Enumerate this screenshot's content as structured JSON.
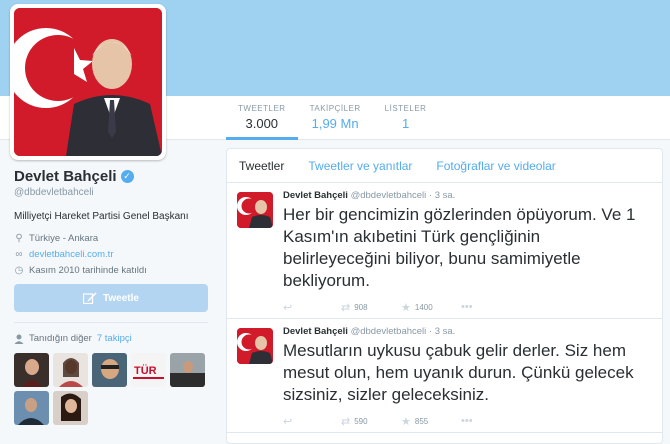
{
  "profile": {
    "name": "Devlet Bahçeli",
    "handle": "@dbdevletbahceli",
    "bio": "Milliyetçi Hareket Partisi Genel Başkanı",
    "location": "Türkiye - Ankara",
    "website": "devletbahceli.com.tr",
    "joined": "Kasım 2010 tarihinde katıldı",
    "tweet_button": "Tweetle"
  },
  "stats": [
    {
      "label": "TWEETLER",
      "value": "3.000"
    },
    {
      "label": "TAKİPÇİLER",
      "value": "1,99 Mn"
    },
    {
      "label": "LİSTELER",
      "value": "1"
    }
  ],
  "known_followers": {
    "label": "Tanıdığın diğer",
    "link": "7 takipçi"
  },
  "tabs": [
    "Tweetler",
    "Tweetler ve yanıtlar",
    "Fotoğraflar ve videolar"
  ],
  "tweets": [
    {
      "name": "Devlet Bahçeli",
      "handle": "@dbdevletbahceli",
      "time": "· 3 sa.",
      "text": "Her bir gencimizin gözlerinden öpüyorum. Ve 1 Kasım'ın akıbetini Türk gençliğinin belirleyeceğini biliyor, bunu samimiyetle bekliyorum.",
      "retweets": "908",
      "favorites": "1400"
    },
    {
      "name": "Devlet Bahçeli",
      "handle": "@dbdevletbahceli",
      "time": "· 3 sa.",
      "text": "Mesutların uykusu çabuk gelir derler. Siz hem mesut olun, hem uyanık durun. Çünkü gelecek sizsiniz, sizler geleceksiniz.",
      "retweets": "590",
      "favorites": "855"
    }
  ],
  "icons": {
    "location": "location-pin-icon",
    "link": "link-icon",
    "calendar": "calendar-icon",
    "verified": "verified-badge-icon",
    "reply": "reply-icon",
    "retweet": "retweet-icon",
    "favorite": "star-icon",
    "more": "more-icon"
  },
  "colors": {
    "banner": "#9fd2f0",
    "accent": "#55acee",
    "flag_red": "#d11b2b",
    "tweet_button": "#b4d5f2"
  }
}
